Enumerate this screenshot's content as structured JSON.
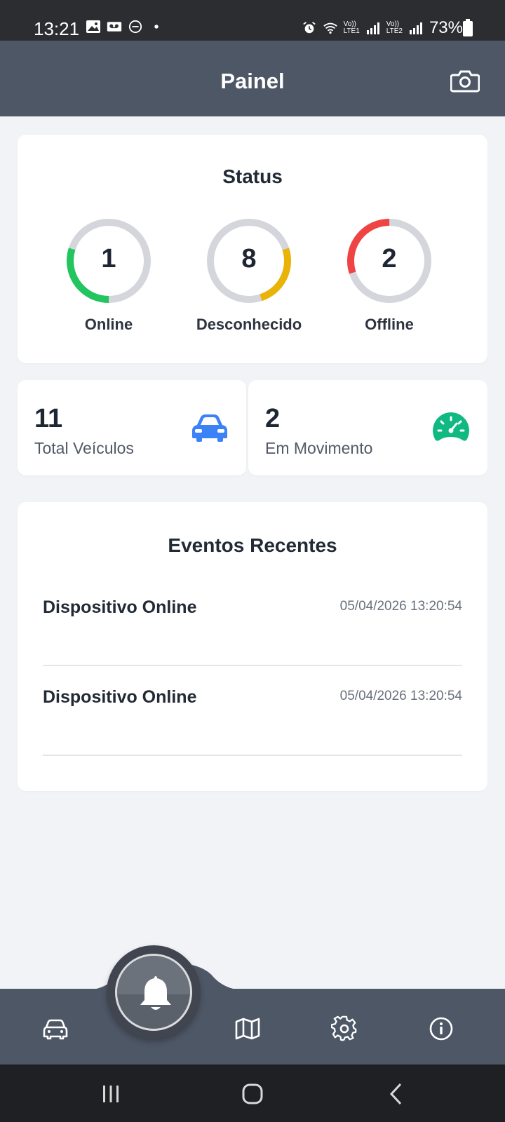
{
  "status_bar": {
    "time": "13:21",
    "lte1": "Vo))\nLTE1",
    "lte2": "Vo))\nLTE2",
    "battery": "73%"
  },
  "header": {
    "title": "Painel",
    "camera_icon": "camera-icon"
  },
  "status": {
    "title": "Status",
    "items": [
      {
        "label": "Online",
        "value": "1",
        "fraction": 0.3,
        "color": "#22c55e"
      },
      {
        "label": "Desconhecido",
        "value": "8",
        "fraction": 0.25,
        "color": "#eab308"
      },
      {
        "label": "Offline",
        "value": "2",
        "fraction": 0.3,
        "color": "#ef4444"
      }
    ],
    "track_color": "#d4d6dc"
  },
  "stats": [
    {
      "value": "11",
      "label": "Total Veículos",
      "icon": "car-icon",
      "color": "#3b82f6"
    },
    {
      "value": "2",
      "label": "Em Movimento",
      "icon": "speedometer-icon",
      "color": "#10b981"
    }
  ],
  "events": {
    "title": "Eventos Recentes",
    "items": [
      {
        "title": "Dispositivo Online",
        "time": "05/04/2026 13:20:54"
      },
      {
        "title": "Dispositivo Online",
        "time": "05/04/2026 13:20:54"
      }
    ]
  },
  "bottom_nav": {
    "items": [
      "car-icon",
      "bell-icon",
      "map-icon",
      "gear-icon",
      "info-icon"
    ]
  }
}
